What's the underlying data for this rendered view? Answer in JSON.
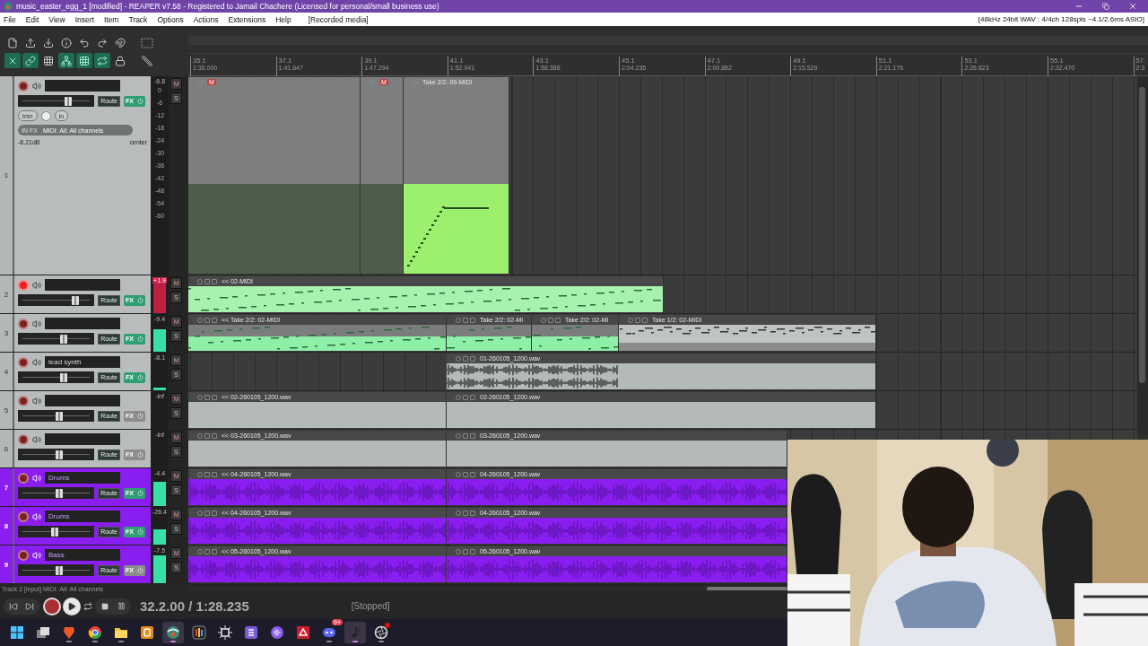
{
  "window": {
    "title": "music_easter_egg_1 [modified] - REAPER v7.58 - Registered to Jamail Chachere (Licensed for personal/small business use)"
  },
  "menu": [
    "File",
    "Edit",
    "View",
    "Insert",
    "Item",
    "Track",
    "Options",
    "Actions",
    "Extensions",
    "Help"
  ],
  "menu_note": "[Recorded media]",
  "audio_info": "[48kHz 24bit WAV : 4/4ch 128spls ~4.1/2.6ms ASIO]",
  "toolbar": {
    "toggles": [
      {
        "on": true
      },
      {
        "on": true
      },
      {
        "on": false
      },
      {
        "on": true
      },
      {
        "on": true
      },
      {
        "on": true
      },
      {
        "on": false
      }
    ]
  },
  "ruler": [
    {
      "bar": "35.1",
      "time": "1:36.000"
    },
    {
      "bar": "37.1",
      "time": "1:41.647"
    },
    {
      "bar": "39.1",
      "time": "1:47.294"
    },
    {
      "bar": "41.1",
      "time": "1:52.941"
    },
    {
      "bar": "43.1",
      "time": "1:58.588"
    },
    {
      "bar": "45.1",
      "time": "2:04.235"
    },
    {
      "bar": "47.1",
      "time": "2:09.882"
    },
    {
      "bar": "49.1",
      "time": "2:15.529"
    },
    {
      "bar": "51.1",
      "time": "2:21.176"
    },
    {
      "bar": "53.1",
      "time": "2:26.823"
    },
    {
      "bar": "55.1",
      "time": "2:32.470"
    },
    {
      "bar": "57.",
      "time": "2:3"
    }
  ],
  "tracks": [
    {
      "number": "1",
      "armed": false,
      "fx_active": true,
      "fader": {
        "level": 0.68
      },
      "meter": {
        "reading": "-6.8",
        "level": 0,
        "clip": false,
        "scale": [
          "0",
          "-6",
          "-12",
          "-18",
          "-24",
          "-30",
          "-36",
          "-42",
          "-48",
          "-54",
          "-60"
        ]
      },
      "buttons": {
        "route": "Route",
        "fx": "FX",
        "mute": "M",
        "solo": "S"
      },
      "input": {
        "trim": "trim",
        "mode": "in",
        "fx_label": "IN FX",
        "source": "MIDI: All: All channels",
        "volume": "-8.21dB",
        "pan": "center"
      },
      "items": [
        {
          "kind": "midi-muted",
          "badge": "M"
        },
        {
          "kind": "midi-muted",
          "badge": "M"
        },
        {
          "kind": "midi",
          "label": "Take 2/2: 09-MIDI"
        }
      ]
    },
    {
      "number": "2",
      "armed": true,
      "fx_active": true,
      "fader": {
        "level": 0.8
      },
      "meter": {
        "reading": "+1.9",
        "level": 0.95,
        "clip": true
      },
      "buttons": {
        "route": "Route",
        "fx": "FX",
        "mute": "M",
        "solo": "S"
      },
      "items": [
        {
          "kind": "midi",
          "label": "<< 02-MIDI"
        }
      ]
    },
    {
      "number": "3",
      "armed": false,
      "fx_active": true,
      "fader": {
        "level": 0.62
      },
      "meter": {
        "reading": "-9.4",
        "level": 0.6,
        "clip": false
      },
      "buttons": {
        "route": "Route",
        "fx": "FX",
        "mute": "M",
        "solo": "S"
      },
      "items": [
        {
          "kind": "midi-take",
          "label": "<< Take 2/2: 02-MIDI"
        },
        {
          "kind": "midi-take",
          "label": "Take 2/2: 02-MI"
        },
        {
          "kind": "midi-take",
          "label": "Take 2/2: 02-MI"
        },
        {
          "kind": "midi-off",
          "label": "Take 1/2: 02-MIDI"
        }
      ]
    },
    {
      "number": "4",
      "name": "lead synth",
      "armed": false,
      "fx_active": true,
      "fader": {
        "level": 0.62
      },
      "meter": {
        "reading": "-8.1",
        "level": 0.08,
        "clip": false
      },
      "buttons": {
        "route": "Route",
        "fx": "FX",
        "mute": "M",
        "solo": "S"
      },
      "items": [
        {
          "kind": "audio",
          "label": "01-260105_1200.wav"
        }
      ]
    },
    {
      "number": "5",
      "armed": false,
      "fx_active": false,
      "fader": {
        "level": 0.55
      },
      "meter": {
        "reading": "-inf",
        "level": 0,
        "clip": false
      },
      "buttons": {
        "route": "Route",
        "fx": "FX",
        "mute": "M",
        "solo": "S"
      },
      "items": [
        {
          "kind": "audio-silent",
          "label": "<< 02-260105_1200.wav"
        },
        {
          "kind": "audio-silent",
          "label": "02-260105_1200.wav"
        }
      ]
    },
    {
      "number": "6",
      "armed": false,
      "fx_active": false,
      "fader": {
        "level": 0.55
      },
      "meter": {
        "reading": "-inf",
        "level": 0,
        "clip": false
      },
      "buttons": {
        "route": "Route",
        "fx": "FX",
        "mute": "M",
        "solo": "S"
      },
      "items": [
        {
          "kind": "audio-silent",
          "label": "<< 03-260105_1200.wav"
        },
        {
          "kind": "audio-silent",
          "label": "03-260105_1200.wav"
        }
      ]
    },
    {
      "number": "7",
      "name": "Drums",
      "color": "#8a1ef0",
      "armed": false,
      "fx_active": true,
      "fader": {
        "level": 0.55
      },
      "meter": {
        "reading": "-4.4",
        "level": 0.65,
        "clip": false
      },
      "buttons": {
        "route": "Route",
        "fx": "FX",
        "mute": "M",
        "solo": "S"
      },
      "items": [
        {
          "kind": "audio",
          "label": "<< 04-260105_1200.wav"
        },
        {
          "kind": "audio",
          "label": "04-260105_1200.wav"
        }
      ]
    },
    {
      "number": "8",
      "name": "Drums",
      "color": "#8a1ef0",
      "armed": false,
      "fx_active": true,
      "fader": {
        "level": 0.48
      },
      "meter": {
        "reading": "-26.4",
        "level": 0.4,
        "clip": false
      },
      "buttons": {
        "route": "Route",
        "fx": "FX",
        "mute": "M",
        "solo": "S"
      },
      "items": [
        {
          "kind": "audio",
          "label": "<< 04-260105_1200.wav"
        },
        {
          "kind": "audio",
          "label": "04-260105_1200.wav"
        }
      ]
    },
    {
      "number": "9",
      "name": "Bass",
      "color": "#8a1ef0",
      "armed": false,
      "fx_active": false,
      "fader": {
        "level": 0.55
      },
      "meter": {
        "reading": "-7.5",
        "level": 0.75,
        "clip": false
      },
      "buttons": {
        "route": "Route",
        "fx": "FX",
        "mute": "M",
        "solo": "S"
      },
      "items": [
        {
          "kind": "audio",
          "label": "<< 05-260105_1200.wav"
        },
        {
          "kind": "audio",
          "label": "05-260105_1200.wav"
        }
      ]
    }
  ],
  "status": "Track 2 [input] MIDI: All: All channels",
  "transport": {
    "position": "32.2.00 / 1:28.235",
    "state": "[Stopped]",
    "record_armed": false
  },
  "webcam": {
    "kind": "picture"
  },
  "taskbar": [
    {
      "kind": "start",
      "active": false,
      "running": false
    },
    {
      "kind": "taskview",
      "active": false,
      "running": false
    },
    {
      "kind": "shield",
      "active": false,
      "running": true
    },
    {
      "kind": "browser",
      "active": false,
      "running": true
    },
    {
      "kind": "folder",
      "active": false,
      "running": true
    },
    {
      "kind": "doc",
      "active": false,
      "running": false
    },
    {
      "kind": "reaper",
      "active": true,
      "running": true
    },
    {
      "kind": "bars",
      "active": false,
      "running": false
    },
    {
      "kind": "sun",
      "active": false,
      "running": false
    },
    {
      "kind": "stack",
      "active": false,
      "running": false
    },
    {
      "kind": "voice",
      "active": false,
      "running": false
    },
    {
      "kind": "redsquare",
      "active": false,
      "running": false
    },
    {
      "kind": "chat",
      "active": false,
      "running": true,
      "badge": "9+"
    },
    {
      "kind": "note",
      "active": true,
      "running": true
    },
    {
      "kind": "lens",
      "active": false,
      "running": true,
      "alert": true
    }
  ]
}
